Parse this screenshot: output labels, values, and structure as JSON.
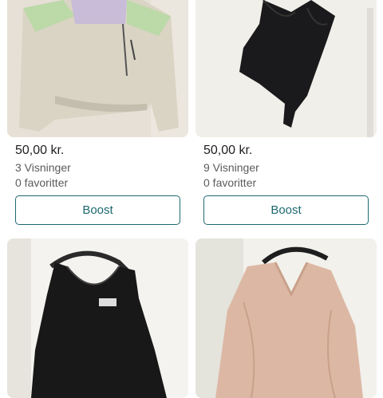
{
  "listings": [
    {
      "price": "50,00 kr.",
      "views": "3 Visninger",
      "favorites": "0 favoritter",
      "boost_label": "Boost",
      "image": "jacket-photo"
    },
    {
      "price": "50,00 kr.",
      "views": "9 Visninger",
      "favorites": "0 favoritter",
      "boost_label": "Boost",
      "image": "black-top-photo"
    },
    {
      "image": "black-dress-photo"
    },
    {
      "image": "pink-blouse-photo"
    }
  ]
}
